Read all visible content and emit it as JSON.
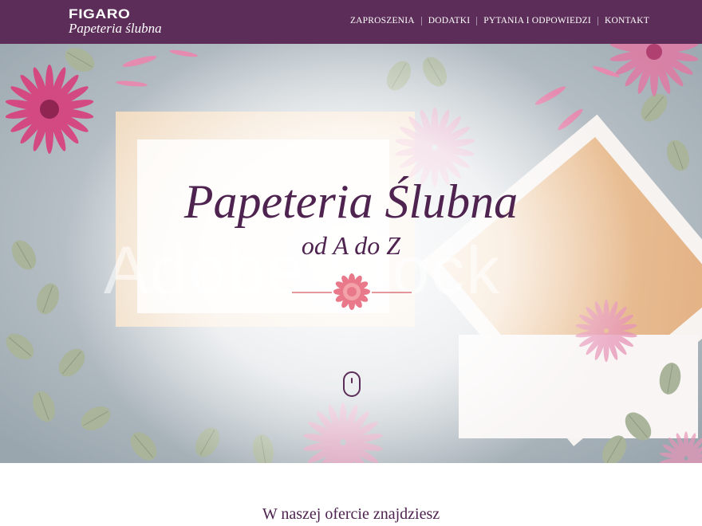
{
  "nav": {
    "logo_top": "FIGARO",
    "logo_bottom": "Papeteria ślubna",
    "items": [
      {
        "label": "ZAPROSZENIA"
      },
      {
        "label": "DODATKI"
      },
      {
        "label": "PYTANIA I ODPOWIEDZI"
      },
      {
        "label": "KONTAKT"
      }
    ]
  },
  "hero": {
    "title": "Papeteria Ślubna",
    "subtitle": "od A do Z",
    "watermark": "Adobe Stock"
  },
  "section": {
    "heading": "W naszej ofercie znajdziesz"
  },
  "colors": {
    "brand_purple": "#5c2d58",
    "text_purple": "#4f2350",
    "flower_pink": "#d6447e",
    "accent_coral": "#e0646a"
  }
}
